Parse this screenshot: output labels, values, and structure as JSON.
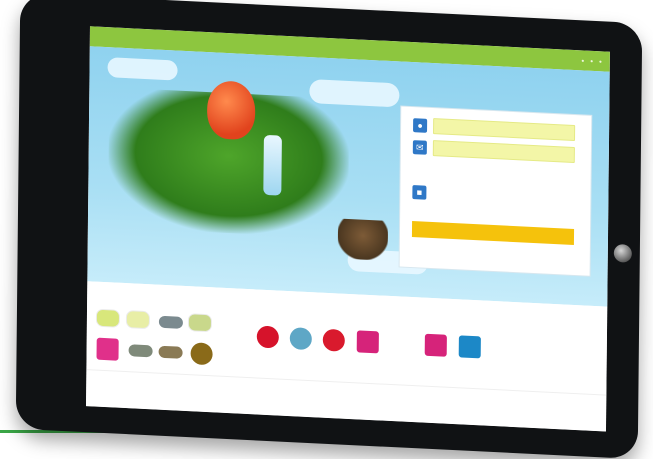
{
  "colors": {
    "topbar": "#8dc63f",
    "login_button": "#f5c20c",
    "input_fill": "#f3f6a7",
    "accent_blue": "#2f78c7",
    "sky": "#a9dff4",
    "bottom_green_line": "#3aa646"
  },
  "icons": {
    "user": "user-icon",
    "email": "email-icon",
    "lock": "lock-icon",
    "home_button": "home-button-icon"
  }
}
